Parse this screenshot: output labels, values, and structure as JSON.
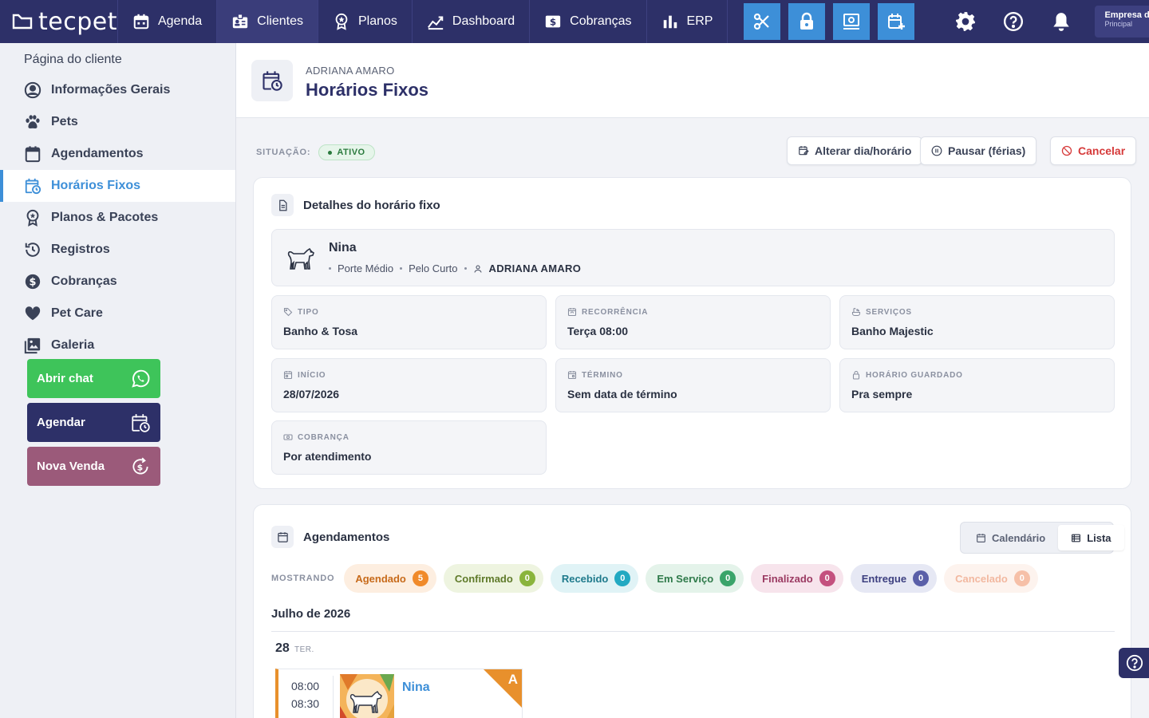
{
  "topbar": {
    "logo": "tecpet",
    "nav": [
      {
        "label": "Agenda",
        "icon": "calendar-icon"
      },
      {
        "label": "Clientes",
        "icon": "clients-icon"
      },
      {
        "label": "Planos",
        "icon": "plans-icon"
      },
      {
        "label": "Dashboard",
        "icon": "chart-icon"
      },
      {
        "label": "Cobranças",
        "icon": "billing-icon"
      },
      {
        "label": "ERP",
        "icon": "bar-chart-icon"
      }
    ],
    "active_nav": "Clientes",
    "tools": [
      "scissors-icon",
      "lock-icon",
      "monitor-icon",
      "calendar-add-icon"
    ],
    "right_icons": [
      "gear-icon",
      "help-icon",
      "bell-icon"
    ],
    "company": {
      "name": "Empresa do Gomes",
      "unit": "Principal"
    }
  },
  "sidebar": {
    "title": "Página do cliente",
    "items": [
      {
        "label": "Informações Gerais",
        "icon": "user-circle-icon"
      },
      {
        "label": "Pets",
        "icon": "paw-icon"
      },
      {
        "label": "Agendamentos",
        "icon": "calendar-icon"
      },
      {
        "label": "Horários Fixos",
        "icon": "calendar-clock-icon"
      },
      {
        "label": "Planos & Pacotes",
        "icon": "award-icon"
      },
      {
        "label": "Registros",
        "icon": "history-icon"
      },
      {
        "label": "Cobranças",
        "icon": "dollar-icon"
      },
      {
        "label": "Pet Care",
        "icon": "heart-icon"
      },
      {
        "label": "Galeria",
        "icon": "gallery-icon"
      }
    ],
    "active_item": "Horários Fixos",
    "buttons": {
      "chat": "Abrir chat",
      "schedule": "Agendar",
      "sale": "Nova Venda"
    },
    "colors": {
      "chat": "#3ec45a",
      "schedule": "#2d3068",
      "sale": "#9b5a7a"
    }
  },
  "header": {
    "client": "ADRIANA AMARO",
    "title": "Horários Fixos"
  },
  "status": {
    "label": "SITUAÇÃO:",
    "value": "ATIVO"
  },
  "actions": {
    "change": "Alterar dia/horário",
    "pause": "Pausar (férias)",
    "cancel": "Cancelar"
  },
  "details": {
    "title": "Detalhes do horário fixo",
    "pet": {
      "name": "Nina",
      "size": "Porte Médio",
      "coat": "Pelo Curto",
      "owner": "ADRIANA AMARO"
    },
    "fields": [
      {
        "label": "TIPO",
        "value": "Banho & Tosa",
        "icon": "tag-icon"
      },
      {
        "label": "RECORRÊNCIA",
        "value": "Terça 08:00",
        "icon": "calendar-repeat-icon"
      },
      {
        "label": "SERVIÇOS",
        "value": "Banho Majestic",
        "icon": "bath-icon"
      },
      {
        "label": "INÍCIO",
        "value": "28/07/2026",
        "icon": "calendar-icon"
      },
      {
        "label": "TÉRMINO",
        "value": "Sem data de término",
        "icon": "calendar-end-icon"
      },
      {
        "label": "HORÁRIO GUARDADO",
        "value": "Pra sempre",
        "icon": "lock-icon"
      },
      {
        "label": "COBRANÇA",
        "value": "Por atendimento",
        "icon": "cash-icon"
      }
    ]
  },
  "appointments": {
    "title": "Agendamentos",
    "view": {
      "calendar": "Calendário",
      "list": "Lista",
      "active": "Lista"
    },
    "filter_label": "MOSTRANDO",
    "filters": [
      {
        "label": "Agendado",
        "count": "5",
        "bg": "#fdeee0",
        "fg": "#c76a1a",
        "badge": "#f08a2a"
      },
      {
        "label": "Confirmado",
        "count": "0",
        "bg": "#eef4e0",
        "fg": "#5f7a2a",
        "badge": "#8ab43c"
      },
      {
        "label": "Recebido",
        "count": "0",
        "bg": "#e0f3f6",
        "fg": "#1f7a8c",
        "badge": "#22a9c2"
      },
      {
        "label": "Em Serviço",
        "count": "0",
        "bg": "#e4f3ea",
        "fg": "#2f7a4a",
        "badge": "#3aa46a"
      },
      {
        "label": "Finalizado",
        "count": "0",
        "bg": "#f7e4ec",
        "fg": "#9b3a62",
        "badge": "#c4507e"
      },
      {
        "label": "Entregue",
        "count": "0",
        "bg": "#e6e8f4",
        "fg": "#3d4080",
        "badge": "#5a5fa8"
      },
      {
        "label": "Cancelado",
        "count": "0",
        "bg": "#fdf3ee",
        "fg": "#f2b8a0",
        "badge": "#f6c0a8"
      }
    ],
    "month": "Julho de 2026",
    "day": {
      "num": "28",
      "weekday": "TER."
    },
    "items": [
      {
        "start": "08:00",
        "end": "08:30",
        "pet": "Nina",
        "letter": "A"
      }
    ]
  }
}
